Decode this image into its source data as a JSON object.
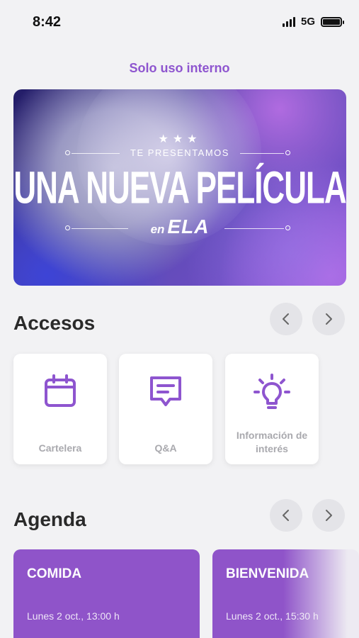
{
  "status_bar": {
    "time": "8:42",
    "network": "5G"
  },
  "header": {
    "label": "Solo uso interno"
  },
  "hero": {
    "stars": "★★★",
    "pre_title": "TE PRESENTAMOS",
    "title": "UNA NUEVA PELÍCULA",
    "sub_small": "en",
    "sub_big": "ELA"
  },
  "accesos": {
    "title": "Accesos",
    "items": [
      {
        "label": "Cartelera",
        "icon": "calendar-icon"
      },
      {
        "label": "Q&A",
        "icon": "chat-icon"
      },
      {
        "label_line1": "Información de",
        "label_line2": "interés",
        "icon": "lightbulb-icon"
      }
    ]
  },
  "agenda": {
    "title": "Agenda",
    "items": [
      {
        "title": "COMIDA",
        "time": "Lunes 2 oct., 13:00 h"
      },
      {
        "title": "BIENVENIDA",
        "time": "Lunes 2 oct., 15:30 h"
      }
    ]
  },
  "colors": {
    "accent": "#8e55cf",
    "card_purple": "#8f54c9",
    "background": "#f2f2f4"
  }
}
